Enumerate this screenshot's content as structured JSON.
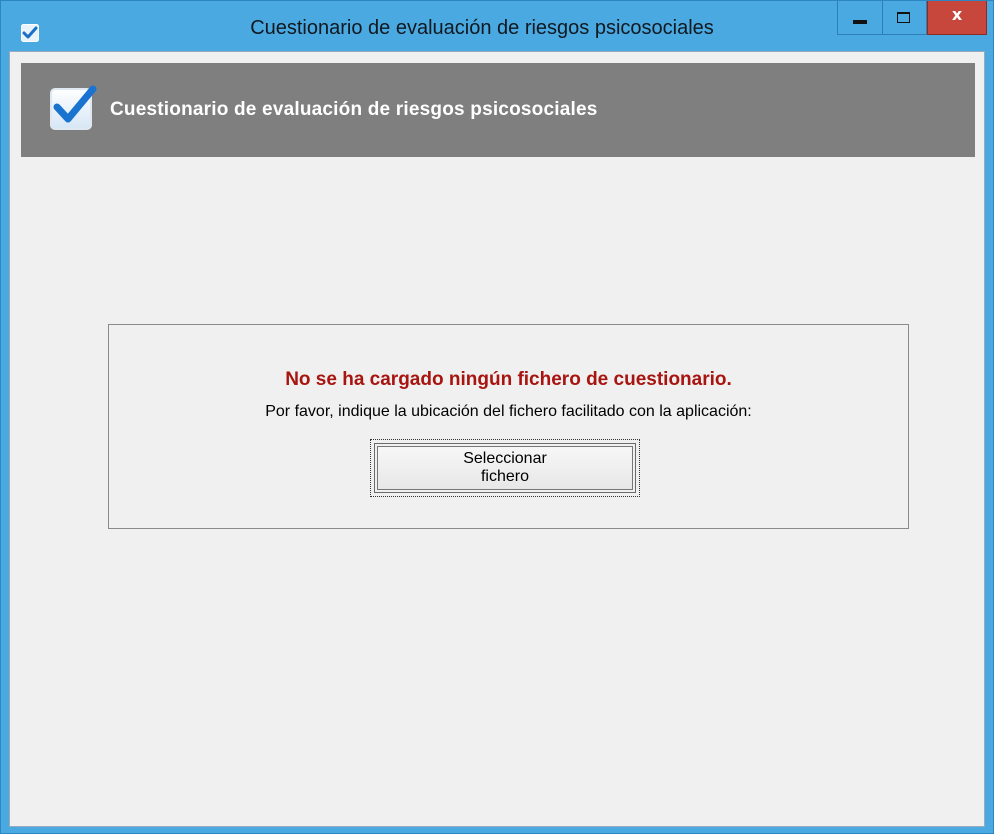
{
  "window": {
    "title": "Cuestionario de evaluación de riesgos psicosociales",
    "controls": {
      "minimize": "minimize",
      "maximize": "maximize",
      "close": "x"
    }
  },
  "header": {
    "title": "Cuestionario de evaluación de riesgos psicosociales",
    "icon": "checkmark-icon"
  },
  "panel": {
    "error_message": "No se ha cargado ningún fichero de cuestionario.",
    "instructions": "Por favor, indique la ubicación del fichero facilitado con la aplicación:",
    "button_label": "Seleccionar fichero"
  },
  "colors": {
    "titlebar": "#4aa9e0",
    "header_band": "#7f7f7f",
    "error_text": "#a8140f",
    "close_button": "#c7473c"
  }
}
